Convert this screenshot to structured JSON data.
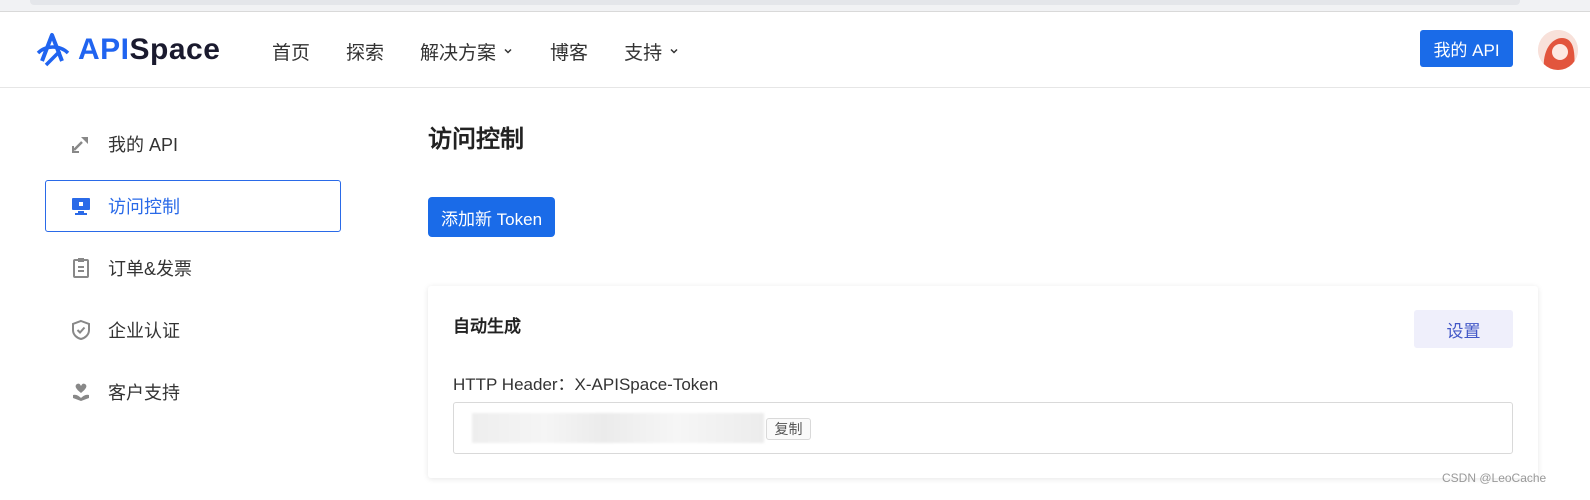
{
  "header": {
    "logo": {
      "api": "API",
      "space": "Space"
    },
    "nav": [
      {
        "label": "首页",
        "has_dropdown": false
      },
      {
        "label": "探索",
        "has_dropdown": false
      },
      {
        "label": "解决方案",
        "has_dropdown": true
      },
      {
        "label": "博客",
        "has_dropdown": false
      },
      {
        "label": "支持",
        "has_dropdown": true
      }
    ],
    "my_api_label": "我的 API"
  },
  "sidebar": {
    "items": [
      {
        "label": "我的 API",
        "icon": "transfer-icon",
        "active": false
      },
      {
        "label": "访问控制",
        "icon": "monitor-icon",
        "active": true
      },
      {
        "label": "订单&发票",
        "icon": "clipboard-icon",
        "active": false
      },
      {
        "label": "企业认证",
        "icon": "shield-check-icon",
        "active": false
      },
      {
        "label": "客户支持",
        "icon": "heart-hand-icon",
        "active": false
      }
    ]
  },
  "main": {
    "title": "访问控制",
    "add_token_label": "添加新 Token",
    "card": {
      "title": "自动生成",
      "settings_label": "设置",
      "header_label": "HTTP Header：X-APISpace-Token",
      "copy_label": "复制"
    }
  },
  "watermark": "CSDN @LeoCache",
  "colors": {
    "accent": "#1a6be8",
    "active_border": "#2a6ae8",
    "settings_bg": "#efeffb",
    "settings_text": "#4257c7"
  }
}
